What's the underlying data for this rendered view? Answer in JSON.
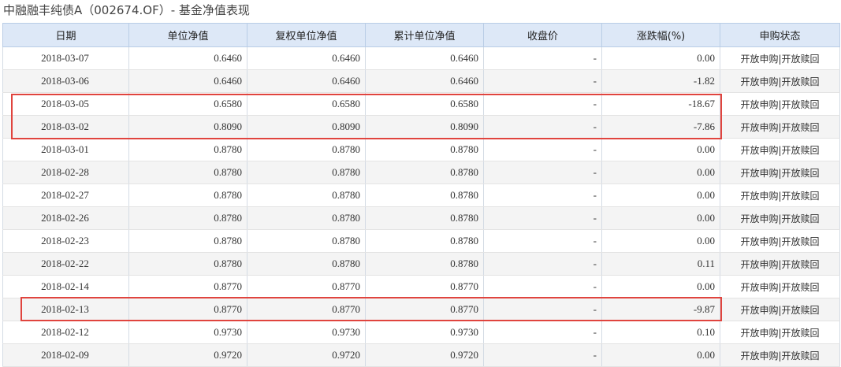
{
  "page": {
    "title": "中融融丰纯债A（002674.OF）- 基金净值表现"
  },
  "table": {
    "headers": [
      "日期",
      "单位净值",
      "复权单位净值",
      "累计单位净值",
      "收盘价",
      "涨跌幅(%)",
      "申购状态"
    ],
    "rows": [
      [
        "2018-03-07",
        "0.6460",
        "0.6460",
        "0.6460",
        "-",
        "0.00",
        "开放申购|开放赎回"
      ],
      [
        "2018-03-06",
        "0.6460",
        "0.6460",
        "0.6460",
        "-",
        "-1.82",
        "开放申购|开放赎回"
      ],
      [
        "2018-03-05",
        "0.6580",
        "0.6580",
        "0.6580",
        "-",
        "-18.67",
        "开放申购|开放赎回"
      ],
      [
        "2018-03-02",
        "0.8090",
        "0.8090",
        "0.8090",
        "-",
        "-7.86",
        "开放申购|开放赎回"
      ],
      [
        "2018-03-01",
        "0.8780",
        "0.8780",
        "0.8780",
        "-",
        "0.00",
        "开放申购|开放赎回"
      ],
      [
        "2018-02-28",
        "0.8780",
        "0.8780",
        "0.8780",
        "-",
        "0.00",
        "开放申购|开放赎回"
      ],
      [
        "2018-02-27",
        "0.8780",
        "0.8780",
        "0.8780",
        "-",
        "0.00",
        "开放申购|开放赎回"
      ],
      [
        "2018-02-26",
        "0.8780",
        "0.8780",
        "0.8780",
        "-",
        "0.00",
        "开放申购|开放赎回"
      ],
      [
        "2018-02-23",
        "0.8780",
        "0.8780",
        "0.8780",
        "-",
        "0.00",
        "开放申购|开放赎回"
      ],
      [
        "2018-02-22",
        "0.8780",
        "0.8780",
        "0.8780",
        "-",
        "0.11",
        "开放申购|开放赎回"
      ],
      [
        "2018-02-14",
        "0.8770",
        "0.8770",
        "0.8770",
        "-",
        "0.00",
        "开放申购|开放赎回"
      ],
      [
        "2018-02-13",
        "0.8770",
        "0.8770",
        "0.8770",
        "-",
        "-9.87",
        "开放申购|开放赎回"
      ],
      [
        "2018-02-12",
        "0.9730",
        "0.9730",
        "0.9730",
        "-",
        "0.10",
        "开放申购|开放赎回"
      ],
      [
        "2018-02-09",
        "0.9720",
        "0.9720",
        "0.9720",
        "-",
        "0.00",
        "开放申购|开放赎回"
      ]
    ]
  },
  "highlight_color": "#e0443e"
}
